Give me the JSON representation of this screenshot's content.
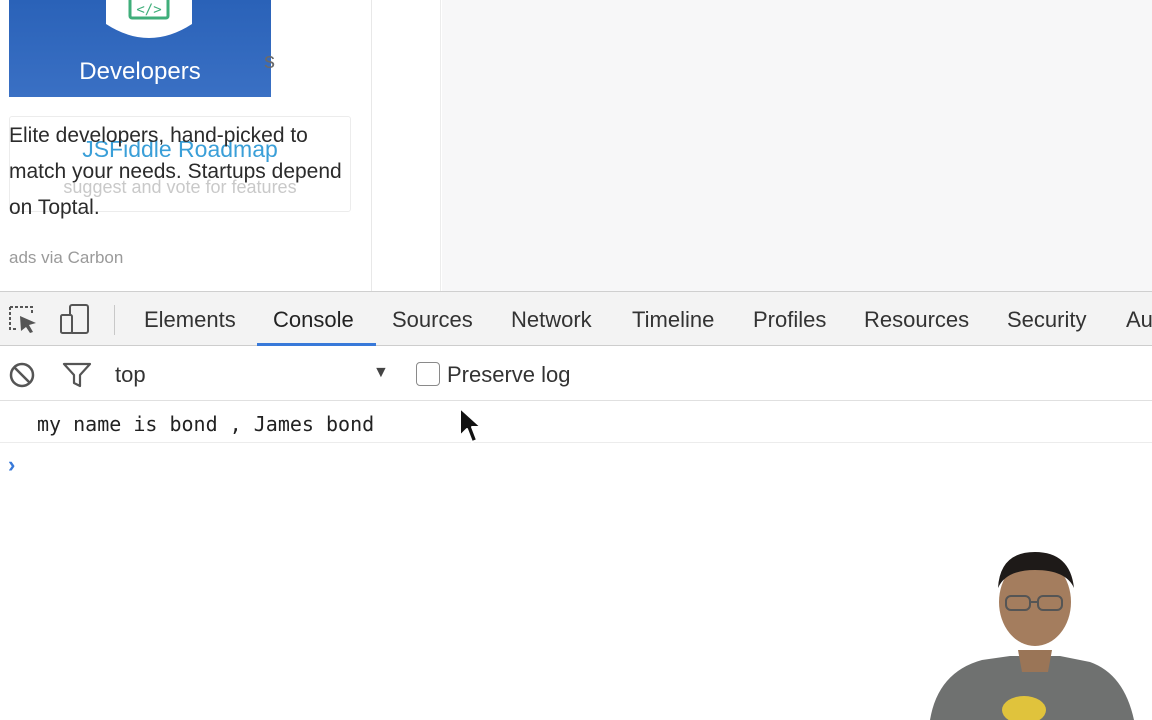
{
  "page": {
    "ad": {
      "banner_text": "Developers",
      "partial_text": "s",
      "description": "Elite developers, hand-picked to match your needs. Startups depend on Toptal.",
      "credit": "ads via Carbon"
    },
    "roadmap": {
      "title": "JSFiddle Roadmap",
      "subtitle": "suggest and vote for features"
    }
  },
  "devtools": {
    "tabs": [
      {
        "label": "Elements",
        "active": false
      },
      {
        "label": "Console",
        "active": true
      },
      {
        "label": "Sources",
        "active": false
      },
      {
        "label": "Network",
        "active": false
      },
      {
        "label": "Timeline",
        "active": false
      },
      {
        "label": "Profiles",
        "active": false
      },
      {
        "label": "Resources",
        "active": false
      },
      {
        "label": "Security",
        "active": false
      },
      {
        "label": "Au",
        "active": false
      }
    ],
    "filter": {
      "context": "top",
      "preserve_log_label": "Preserve log",
      "preserve_log_checked": false
    },
    "console": {
      "messages": [
        "my name is bond , James bond"
      ],
      "prompt": "›"
    },
    "accent_color": "#3879d9"
  },
  "icons": {
    "inspect": "inspect-element-icon",
    "device": "device-mode-icon",
    "clear": "clear-console-icon",
    "filter": "filter-icon"
  }
}
